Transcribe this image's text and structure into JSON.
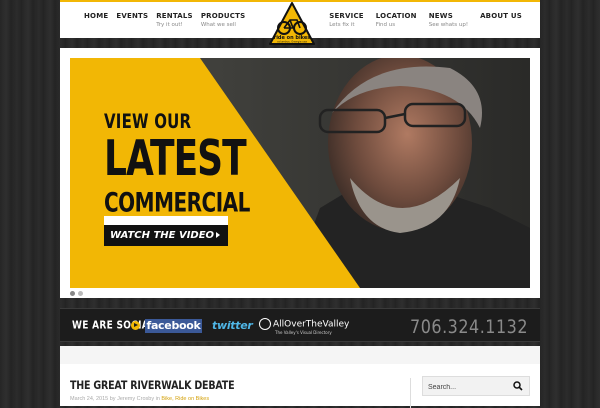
{
  "nav": {
    "left": [
      {
        "label": "HOME",
        "sub": ""
      },
      {
        "label": "EVENTS",
        "sub": ""
      },
      {
        "label": "RENTALS",
        "sub": "Try it out!"
      },
      {
        "label": "PRODUCTS",
        "sub": "What we sell"
      }
    ],
    "right": [
      {
        "label": "SERVICE",
        "sub": "Lets fix it"
      },
      {
        "label": "LOCATION",
        "sub": "Find us"
      },
      {
        "label": "NEWS",
        "sub": "See whats up!"
      },
      {
        "label": "ABOUT US",
        "sub": ""
      }
    ]
  },
  "logo": {
    "name": "ride on bikes",
    "tagline": "columbus, Georgia usa"
  },
  "hero": {
    "line1": "VIEW OUR",
    "line2": "LATEST",
    "line3": "COMMERCIAL",
    "button": "WATCH THE VIDEO",
    "slide_count": 2,
    "active_slide": 1
  },
  "social": {
    "label": "WE ARE SOCIAL",
    "facebook": "facebook",
    "twitter": "twitter",
    "allover": "AllOverTheValley",
    "allover_sub": "The Valley's Visual Directory",
    "phone": "706.324.1132"
  },
  "post": {
    "title": "THE GREAT RIVERWALK DEBATE",
    "date": "March 24, 2015 by",
    "author": "Jeremy Crosby in",
    "categories": "Bike, Ride on Bikes"
  },
  "search": {
    "placeholder": "Search..."
  },
  "colors": {
    "accent": "#f2b705",
    "facebook": "#3b5998",
    "twitter": "#4fb6e6"
  }
}
